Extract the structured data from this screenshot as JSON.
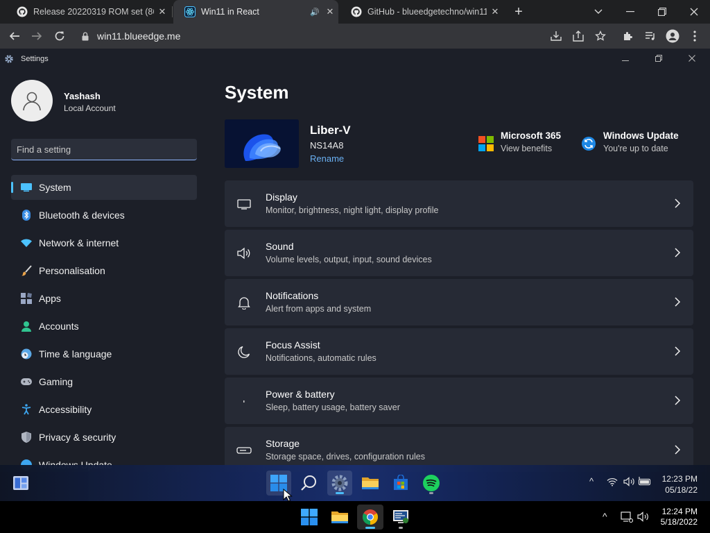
{
  "browser": {
    "tabs": [
      {
        "title": "Release 20220319 ROM set (86B",
        "icon": "github-icon",
        "active": false
      },
      {
        "title": "Win11 in React",
        "icon": "win11-react-icon",
        "active": true
      },
      {
        "title": "GitHub - blueedgetechno/win11",
        "icon": "github-icon",
        "active": false
      }
    ],
    "close_glyph": "✕",
    "speaker_glyph": "🔊",
    "new_tab_glyph": "+",
    "url": "win11.blueedge.me",
    "window_controls": {
      "dropdown": "⌄",
      "minimize": "—",
      "restore": "❐",
      "close": "✕"
    }
  },
  "settings": {
    "window_title": "Settings",
    "window_controls": {
      "minimize": "—",
      "restore": "❐",
      "close": "✕"
    },
    "user": {
      "name": "Yashash",
      "account": "Local Account"
    },
    "search": {
      "placeholder": "Find a setting"
    },
    "nav": [
      {
        "label": "System",
        "icon": "system-icon",
        "color": "#4cc2ff",
        "active": true
      },
      {
        "label": "Bluetooth & devices",
        "icon": "bluetooth-icon",
        "color": "#3a8ee6",
        "active": false
      },
      {
        "label": "Network & internet",
        "icon": "wifi-icon",
        "color": "#4cc2ff",
        "active": false
      },
      {
        "label": "Personalisation",
        "icon": "brush-icon",
        "color": "#e8a24a",
        "active": false
      },
      {
        "label": "Apps",
        "icon": "apps-icon",
        "color": "#9aa7c4",
        "active": false
      },
      {
        "label": "Accounts",
        "icon": "accounts-icon",
        "color": "#30c490",
        "active": false
      },
      {
        "label": "Time & language",
        "icon": "clock-globe-icon",
        "color": "#5ba8e6",
        "active": false
      },
      {
        "label": "Gaming",
        "icon": "gamepad-icon",
        "color": "#b0b6c2",
        "active": false
      },
      {
        "label": "Accessibility",
        "icon": "accessibility-icon",
        "color": "#3da6f0",
        "active": false
      },
      {
        "label": "Privacy & security",
        "icon": "shield-icon",
        "color": "#b0b6c2",
        "active": false
      },
      {
        "label": "Windows Update",
        "icon": "update-icon",
        "color": "#3da6f0",
        "active": false
      }
    ],
    "page_title": "System",
    "device": {
      "name": "Liber-V",
      "model": "NS14A8",
      "rename": "Rename"
    },
    "promos": [
      {
        "title": "Microsoft 365",
        "subtitle": "View benefits",
        "icon": "microsoft-logo-icon"
      },
      {
        "title": "Windows Update",
        "subtitle": "You're up to date",
        "icon": "windows-update-icon"
      }
    ],
    "cards": [
      {
        "title": "Display",
        "subtitle": "Monitor, brightness, night light, display profile",
        "icon": "display-icon"
      },
      {
        "title": "Sound",
        "subtitle": "Volume levels, output, input, sound devices",
        "icon": "speaker-icon"
      },
      {
        "title": "Notifications",
        "subtitle": "Alert from apps and system",
        "icon": "bell-icon"
      },
      {
        "title": "Focus Assist",
        "subtitle": "Notifications, automatic rules",
        "icon": "moon-icon"
      },
      {
        "title": "Power & battery",
        "subtitle": "Sleep, battery usage, battery saver",
        "icon": "power-icon"
      },
      {
        "title": "Storage",
        "subtitle": "Storage space, drives, configuration rules",
        "icon": "storage-icon"
      }
    ]
  },
  "win11_taskbar": {
    "time": "12:23 PM",
    "date": "05/18/22",
    "tray": {
      "chevron": "^"
    }
  },
  "host_taskbar": {
    "time": "12:24 PM",
    "date": "5/18/2022",
    "tray": {
      "chevron": "^"
    }
  },
  "colors": {
    "accent": "#4cc2ff",
    "link": "#6ab0f2",
    "settings_bg": "#1c1f28",
    "card_bg": "#262a35",
    "chrome_tab_bar": "#1f2022",
    "chrome_toolbar": "#35363a"
  }
}
